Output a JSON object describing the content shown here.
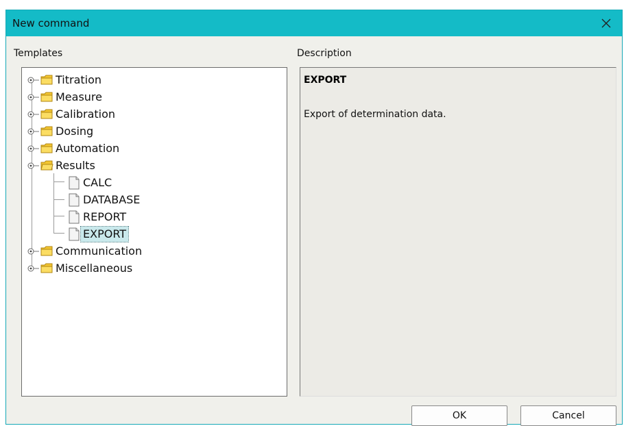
{
  "window": {
    "title": "New command"
  },
  "labels": {
    "templates": "Templates",
    "description": "Description"
  },
  "tree": {
    "folders": [
      {
        "label": "Titration"
      },
      {
        "label": "Measure"
      },
      {
        "label": "Calibration"
      },
      {
        "label": "Dosing"
      },
      {
        "label": "Automation"
      },
      {
        "label": "Results",
        "expanded": true,
        "children": [
          "CALC",
          "DATABASE",
          "REPORT",
          "EXPORT"
        ]
      },
      {
        "label": "Communication"
      },
      {
        "label": "Miscellaneous"
      }
    ],
    "selected": "EXPORT"
  },
  "description": {
    "title": "EXPORT",
    "text": "Export of determination data."
  },
  "buttons": {
    "ok": "OK",
    "cancel": "Cancel"
  },
  "colors": {
    "titlebar": "#14bbc7",
    "selection": "#c9e9ec",
    "folder": "#f3c631"
  }
}
